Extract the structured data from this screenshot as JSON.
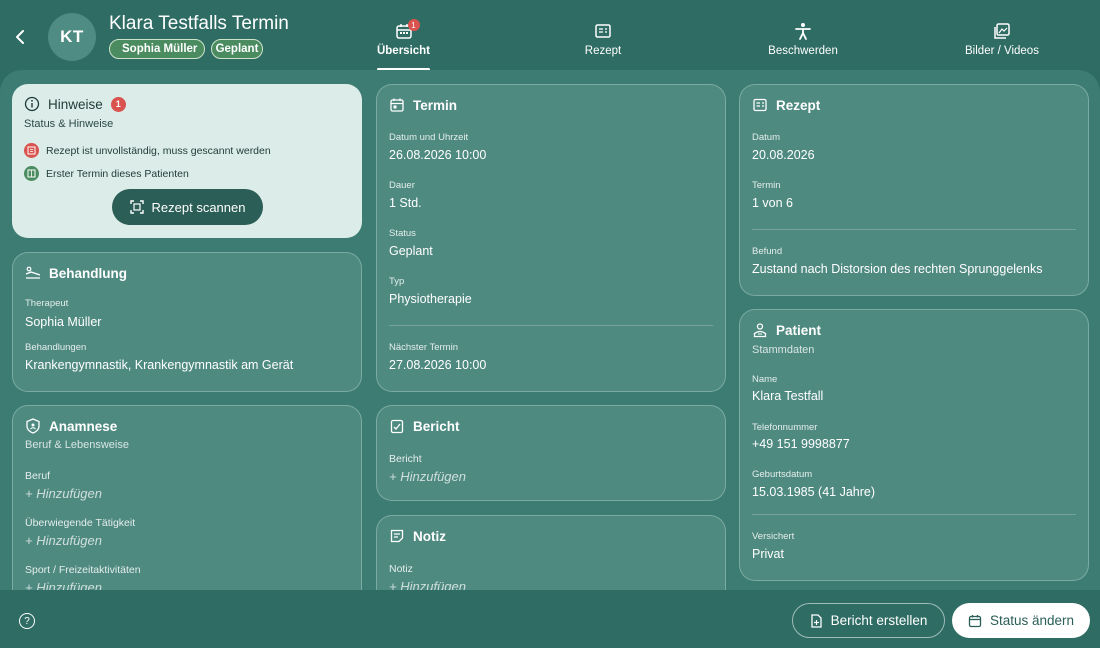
{
  "header": {
    "back_icon": "chevron-left-icon",
    "avatar_initials": "KT",
    "title": "Klara Testfalls Termin",
    "chips": {
      "therapist": "Sophia Müller",
      "status": "Geplant"
    },
    "tabs": [
      {
        "label": "Übersicht",
        "icon": "calendar-icon",
        "badge": "1"
      },
      {
        "label": "Rezept",
        "icon": "prescription-icon"
      },
      {
        "label": "Beschwerden",
        "icon": "person-icon"
      },
      {
        "label": "Bilder / Videos",
        "icon": "images-icon"
      }
    ]
  },
  "hinweise": {
    "title": "Hinweise",
    "badge": "1",
    "subtitle": "Status & Hinweise",
    "items": [
      "Rezept ist unvollständig, muss gescannt werden",
      "Erster Termin dieses Patienten"
    ],
    "scan_button": "Rezept scannen"
  },
  "behandlung": {
    "title": "Behandlung",
    "therapeut_label": "Therapeut",
    "therapeut_value": "Sophia Müller",
    "behandlungen_label": "Behandlungen",
    "behandlungen_value": "Krankengymnastik, Krankengymnastik am Gerät"
  },
  "anamnese": {
    "title": "Anamnese",
    "subtitle": "Beruf & Lebensweise",
    "fields": [
      {
        "label": "Beruf",
        "value": "Hinzufügen"
      },
      {
        "label": "Überwiegende Tätigkeit",
        "value": "Hinzufügen"
      },
      {
        "label": "Sport / Freizeitaktivitäten",
        "value": "Hinzufügen"
      }
    ]
  },
  "termin": {
    "title": "Termin",
    "datum_label": "Datum und Uhrzeit",
    "datum_value": "26.08.2026 10:00",
    "dauer_label": "Dauer",
    "dauer_value": "1 Std.",
    "status_label": "Status",
    "status_value": "Geplant",
    "typ_label": "Typ",
    "typ_value": "Physiotherapie",
    "naechster_label": "Nächster Termin",
    "naechster_value": "27.08.2026 10:00"
  },
  "bericht": {
    "title": "Bericht",
    "label": "Bericht",
    "add": "Hinzufügen"
  },
  "notiz": {
    "title": "Notiz",
    "label": "Notiz",
    "add": "Hinzufügen"
  },
  "rezept": {
    "title": "Rezept",
    "datum_label": "Datum",
    "datum_value": "20.08.2026",
    "termin_label": "Termin",
    "termin_value": "1 von 6",
    "befund_label": "Befund",
    "befund_value": "Zustand nach Distorsion des rechten Sprunggelenks"
  },
  "patient": {
    "title": "Patient",
    "subtitle": "Stammdaten",
    "name_label": "Name",
    "name_value": "Klara Testfall",
    "telefon_label": "Telefonnummer",
    "telefon_value": "+49 151 9998877",
    "geburt_label": "Geburtsdatum",
    "geburt_value": "15.03.1985 (41 Jahre)",
    "versichert_label": "Versichert",
    "versichert_value": "Privat"
  },
  "footer": {
    "help_icon": "help-circle-icon",
    "bericht_button": "Bericht erstellen",
    "status_button": "Status ändern"
  },
  "colors": {
    "primary": "#2e6c64",
    "content": "#3d7c73",
    "light_card": "#dcece9",
    "badge_red": "#d9534f",
    "chip_green": "#4b8b60"
  }
}
